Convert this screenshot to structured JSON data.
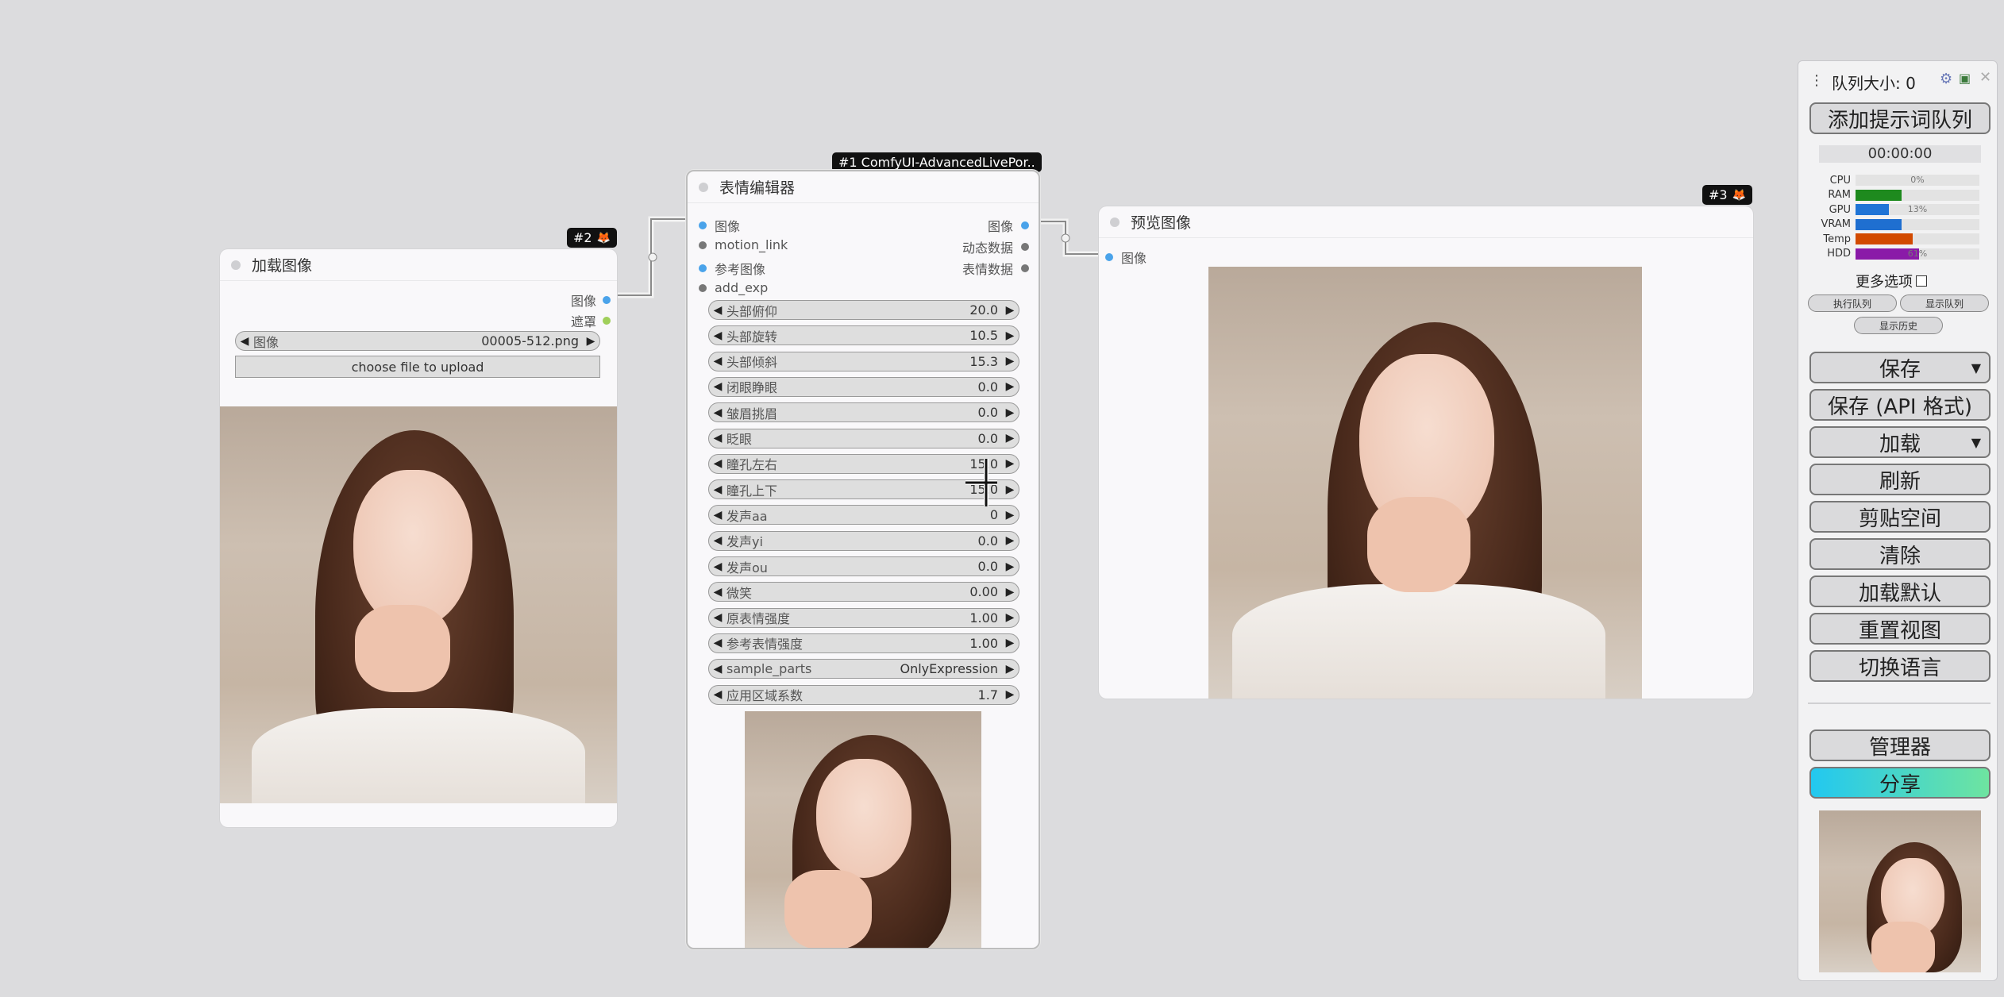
{
  "load_node": {
    "badge": "#2",
    "title": "加载图像",
    "outputs": [
      "图像",
      "遮罩"
    ],
    "image_widget": {
      "label": "图像",
      "value": "00005-512.png"
    },
    "upload_label": "choose file to upload"
  },
  "editor_node": {
    "badge": "#1 ComfyUI-AdvancedLivePor..",
    "title": "表情编辑器",
    "inputs": [
      "图像",
      "motion_link",
      "参考图像",
      "add_exp"
    ],
    "outputs": [
      "图像",
      "动态数据",
      "表情数据"
    ],
    "widgets": [
      {
        "label": "头部俯仰",
        "value": "20.0"
      },
      {
        "label": "头部旋转",
        "value": "10.5"
      },
      {
        "label": "头部倾斜",
        "value": "15.3"
      },
      {
        "label": "闭眼睁眼",
        "value": "0.0"
      },
      {
        "label": "皱眉挑眉",
        "value": "0.0"
      },
      {
        "label": "眨眼",
        "value": "0.0"
      },
      {
        "label": "瞳孔左右",
        "value": "15.0"
      },
      {
        "label": "瞳孔上下",
        "value": "15.0"
      },
      {
        "label": "发声aa",
        "value": "0"
      },
      {
        "label": "发声yi",
        "value": "0.0"
      },
      {
        "label": "发声ou",
        "value": "0.0"
      },
      {
        "label": "微笑",
        "value": "0.00"
      },
      {
        "label": "原表情强度",
        "value": "1.00"
      },
      {
        "label": "参考表情强度",
        "value": "1.00"
      },
      {
        "label": "sample_parts",
        "value": "OnlyExpression"
      },
      {
        "label": "应用区域系数",
        "value": "1.7"
      }
    ]
  },
  "preview_node": {
    "badge": "#3",
    "title": "预览图像",
    "inputs": [
      "图像"
    ]
  },
  "panel": {
    "queue_label": "队列大小: 0",
    "queue_prompt": "添加提示词队列",
    "timer": "00:00:00",
    "stats": [
      {
        "name": "CPU",
        "pct": 0,
        "label": "0%",
        "color": "#2a8c2a"
      },
      {
        "name": "RAM",
        "pct": 37,
        "label": "",
        "color": "#1e8a1e"
      },
      {
        "name": "GPU",
        "pct": 27,
        "label": "13%",
        "color": "#1f74d6"
      },
      {
        "name": "VRAM",
        "pct": 37,
        "label": "",
        "color": "#1f6fd0"
      },
      {
        "name": "Temp",
        "pct": 46,
        "label": "",
        "color": "#d24a00"
      },
      {
        "name": "HDD",
        "pct": 51,
        "label": "61%",
        "color": "#8a1aa8"
      }
    ],
    "more_options": "更多选项",
    "queue_btn": "执行队列",
    "view_queue": "显示队列",
    "view_history": "显示历史",
    "buttons": {
      "save": "保存",
      "save_api": "保存 (API 格式)",
      "load": "加载",
      "refresh": "刷新",
      "clipspace": "剪贴空间",
      "clear": "清除",
      "load_default": "加载默认",
      "reset_view": "重置视图",
      "switch_lang": "切换语言",
      "manager": "管理器",
      "share": "分享"
    }
  }
}
